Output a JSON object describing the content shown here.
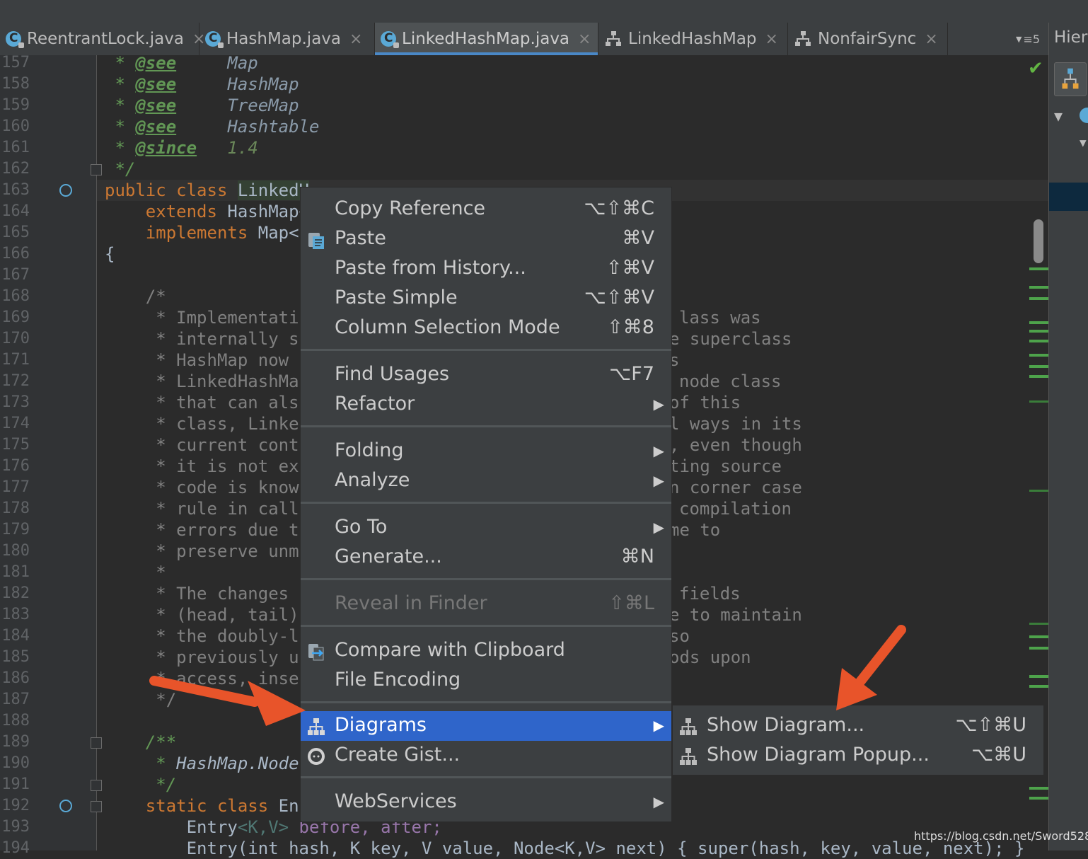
{
  "tabs": [
    {
      "label": "ReentrantLock.java",
      "icon": "class-icon",
      "active": false
    },
    {
      "label": "HashMap.java",
      "icon": "class-icon",
      "active": false
    },
    {
      "label": "LinkedHashMap.java",
      "icon": "class-icon",
      "active": true
    },
    {
      "label": "LinkedHashMap",
      "icon": "hierarchy-icon",
      "active": false
    },
    {
      "label": "NonfairSync",
      "icon": "hierarchy-icon",
      "active": false
    }
  ],
  "tabs_overflow": {
    "label": "≡5"
  },
  "right_panel": {
    "title": "Hier"
  },
  "line_numbers": [
    "157",
    "158",
    "159",
    "160",
    "161",
    "162",
    "163",
    "164",
    "165",
    "166",
    "167",
    "168",
    "169",
    "170",
    "171",
    "172",
    "173",
    "174",
    "175",
    "176",
    "177",
    "178",
    "179",
    "180",
    "181",
    "182",
    "183",
    "184",
    "185",
    "186",
    "187",
    "188",
    "189",
    "190",
    "191",
    "192",
    "193",
    "194"
  ],
  "code": {
    "l157": {
      "star": "*",
      "tag": "@see",
      "ref": "Map"
    },
    "l158": {
      "star": "*",
      "tag": "@see",
      "ref": "HashMap"
    },
    "l159": {
      "star": "*",
      "tag": "@see",
      "ref": "TreeMap"
    },
    "l160": {
      "star": "*",
      "tag": "@see",
      "ref": "Hashtable"
    },
    "l161": {
      "star": "*",
      "tag": "@since",
      "ref": "1.4"
    },
    "l162": "*/",
    "l163": {
      "kw": "public class",
      "name": "LinkedH",
      "rest": "ashMap<K,V>"
    },
    "l164": {
      "kw": "extends",
      "rest": "HashMap<"
    },
    "l165": {
      "kw": "implements",
      "rest": "Map<K"
    },
    "l166": "{",
    "l168": "/*",
    "l169": {
      "left": "* Implementatio",
      "right": "lass was"
    },
    "l170": {
      "left": "* internally st",
      "right": "e superclass"
    },
    "l171": {
      "left": "* HashMap now u",
      "right": "s"
    },
    "l172": {
      "left": "* LinkedHashMap",
      "right": "node class"
    },
    "l173": {
      "left": "* that can also",
      "right": "of this"
    },
    "l174": {
      "left": "* class, Linked",
      "right": "l ways in its"
    },
    "l175": {
      "left": "* current conte",
      "right": ", even though"
    },
    "l176": {
      "left": "* it is not exp",
      "right": "ting source"
    },
    "l177": {
      "left": "* code is known",
      "right": "n corner case"
    },
    "l178": {
      "left": "* rule in calls",
      "right": "compilation"
    },
    "l179": {
      "left": "* errors due to",
      "right": "me to"
    },
    "l180": {
      "left": "* preserve unmo",
      "right": ""
    },
    "l181": "*",
    "l182": {
      "left": "* The changes i",
      "right": "fields"
    },
    "l183": {
      "left": "* (head, tail)",
      "right": "e to maintain"
    },
    "l184": {
      "left": "* the doubly-li",
      "right": "so"
    },
    "l185": {
      "left": "* previously us",
      "right": "ods upon"
    },
    "l186": {
      "left": "* access, inser",
      "right": ""
    },
    "l187": "*/",
    "l189": "/**",
    "l190": {
      "star": "*",
      "ref": "HashMap.Node"
    },
    "l191": "*/",
    "l192": {
      "kw": "static class",
      "rest": "Ent"
    },
    "l193": {
      "type": "Entry",
      "gen": "<K,V>",
      "fields": "before, after;"
    },
    "l194": {
      "left": "Entry(int hash, K key, V value, Node<K,V> next) { super(hash, key, value, next); }"
    }
  },
  "context_menu": [
    {
      "label": "Copy Reference",
      "shortcut": "⌥⇧⌘C"
    },
    {
      "label": "Paste",
      "shortcut": "⌘V",
      "icon": "clipboard-icon"
    },
    {
      "label": "Paste from History...",
      "shortcut": "⇧⌘V"
    },
    {
      "label": "Paste Simple",
      "shortcut": "⌥⇧⌘V"
    },
    {
      "label": "Column Selection Mode",
      "shortcut": "⇧⌘8"
    },
    {
      "label": "Find Usages",
      "shortcut": "⌥F7"
    },
    {
      "label": "Refactor",
      "submenu": true
    },
    {
      "label": "Folding",
      "submenu": true
    },
    {
      "label": "Analyze",
      "submenu": true
    },
    {
      "label": "Go To",
      "submenu": true
    },
    {
      "label": "Generate...",
      "shortcut": "⌘N"
    },
    {
      "label": "Reveal in Finder",
      "shortcut": "⇧⌘L",
      "disabled": true
    },
    {
      "label": "Compare with Clipboard",
      "icon": "compare-icon"
    },
    {
      "label": "File Encoding"
    },
    {
      "label": "Diagrams",
      "submenu": true,
      "selected": true,
      "icon": "diagram-icon"
    },
    {
      "label": "Create Gist...",
      "icon": "github-icon"
    },
    {
      "label": "WebServices",
      "submenu": true
    }
  ],
  "diagrams_submenu": [
    {
      "label": "Show Diagram...",
      "shortcut": "⌥⇧⌘U"
    },
    {
      "label": "Show Diagram Popup...",
      "shortcut": "⌥⌘U"
    }
  ],
  "watermark": "https://blog.csdn.net/Sword52888",
  "colors": {
    "accent": "#2f65ca",
    "annotation_arrow": "#e8542a",
    "tab_underline": "#4a88c7"
  }
}
